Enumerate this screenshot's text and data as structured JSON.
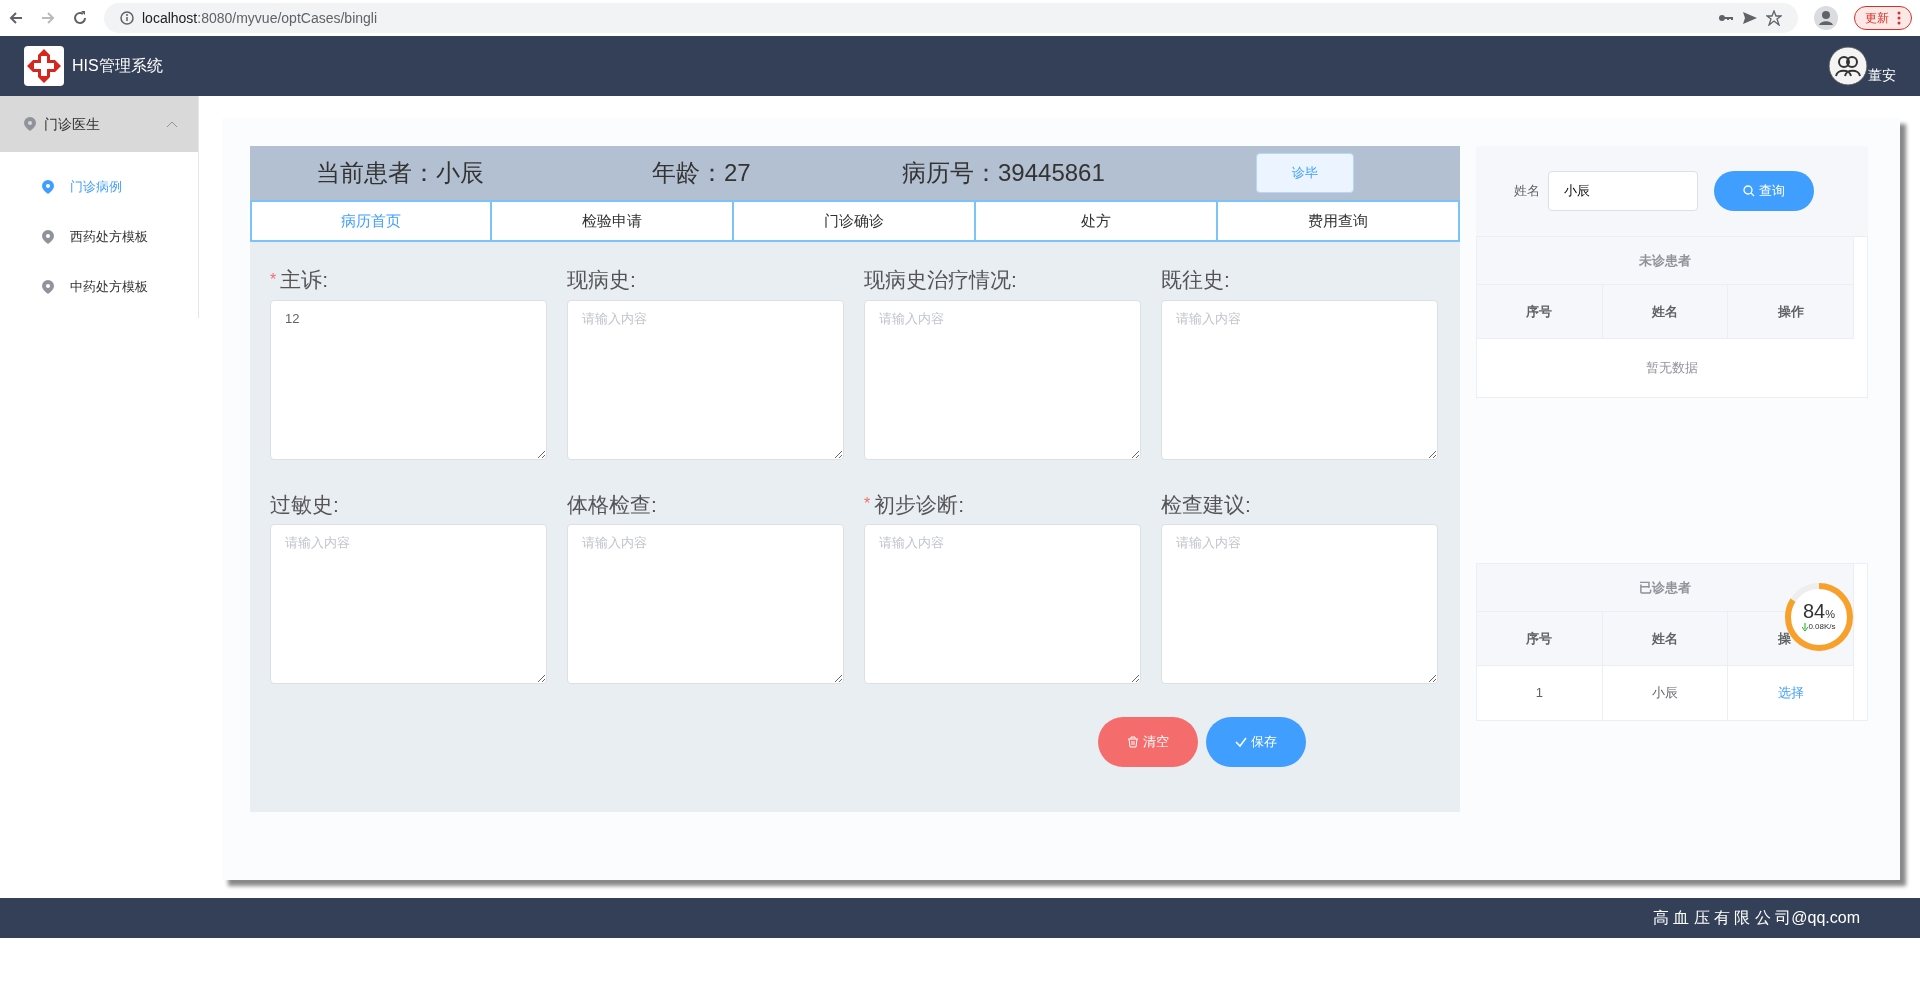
{
  "browser": {
    "url_host": "localhost",
    "url_rest": ":8080/myvue/optCases/bingli",
    "update_button": "更新"
  },
  "header": {
    "title": "HIS管理系统",
    "user": "董安"
  },
  "sidebar": {
    "group": {
      "label": "门诊医生",
      "expanded": true
    },
    "items": [
      {
        "label": "门诊病例",
        "selected": true
      },
      {
        "label": "西药处方模板",
        "selected": false
      },
      {
        "label": "中药处方模板",
        "selected": false
      }
    ]
  },
  "patient_bar": {
    "patient": "当前患者：小辰",
    "age": "年龄：27",
    "record_no": "病历号：39445861",
    "finish_button": "诊毕"
  },
  "tabs": [
    {
      "label": "病历首页",
      "selected": true
    },
    {
      "label": "检验申请",
      "selected": false
    },
    {
      "label": "门诊确诊",
      "selected": false
    },
    {
      "label": "处方",
      "selected": false
    },
    {
      "label": "费用查询",
      "selected": false
    }
  ],
  "fields": [
    {
      "marker": "*",
      "label": "主诉:",
      "value": "12"
    },
    {
      "label": "现病史:",
      "placeholder": "请输入内容"
    },
    {
      "label": "现病史治疗情况:",
      "placeholder": "请输入内容"
    },
    {
      "label": "既往史:",
      "placeholder": "请输入内容"
    },
    {
      "label": "过敏史:",
      "placeholder": "请输入内容"
    },
    {
      "label": "体格检查:",
      "placeholder": "请输入内容"
    },
    {
      "marker": "*",
      "label": "初步诊断:",
      "placeholder": "请输入内容"
    },
    {
      "label": "检查建议:",
      "placeholder": "请输入内容"
    }
  ],
  "actions": {
    "clear": "清空",
    "save": "保存"
  },
  "search": {
    "label": "姓名",
    "value": "小辰",
    "button": "查询"
  },
  "waiting_table": {
    "title": "未诊患者",
    "columns": [
      "序号",
      "姓名",
      "操作"
    ],
    "empty": "暂无数据"
  },
  "done_table": {
    "title": "已诊患者",
    "columns": [
      "序号",
      "姓名",
      "操"
    ],
    "rows": [
      {
        "no": "1",
        "name": "小辰",
        "action": "选择"
      }
    ]
  },
  "speed_widget": {
    "level": 0.84,
    "value": "84",
    "unit": "%",
    "speed": "0.08K/s"
  },
  "footer": {
    "text": "高 血 压 有 限 公 司@qq.com"
  }
}
